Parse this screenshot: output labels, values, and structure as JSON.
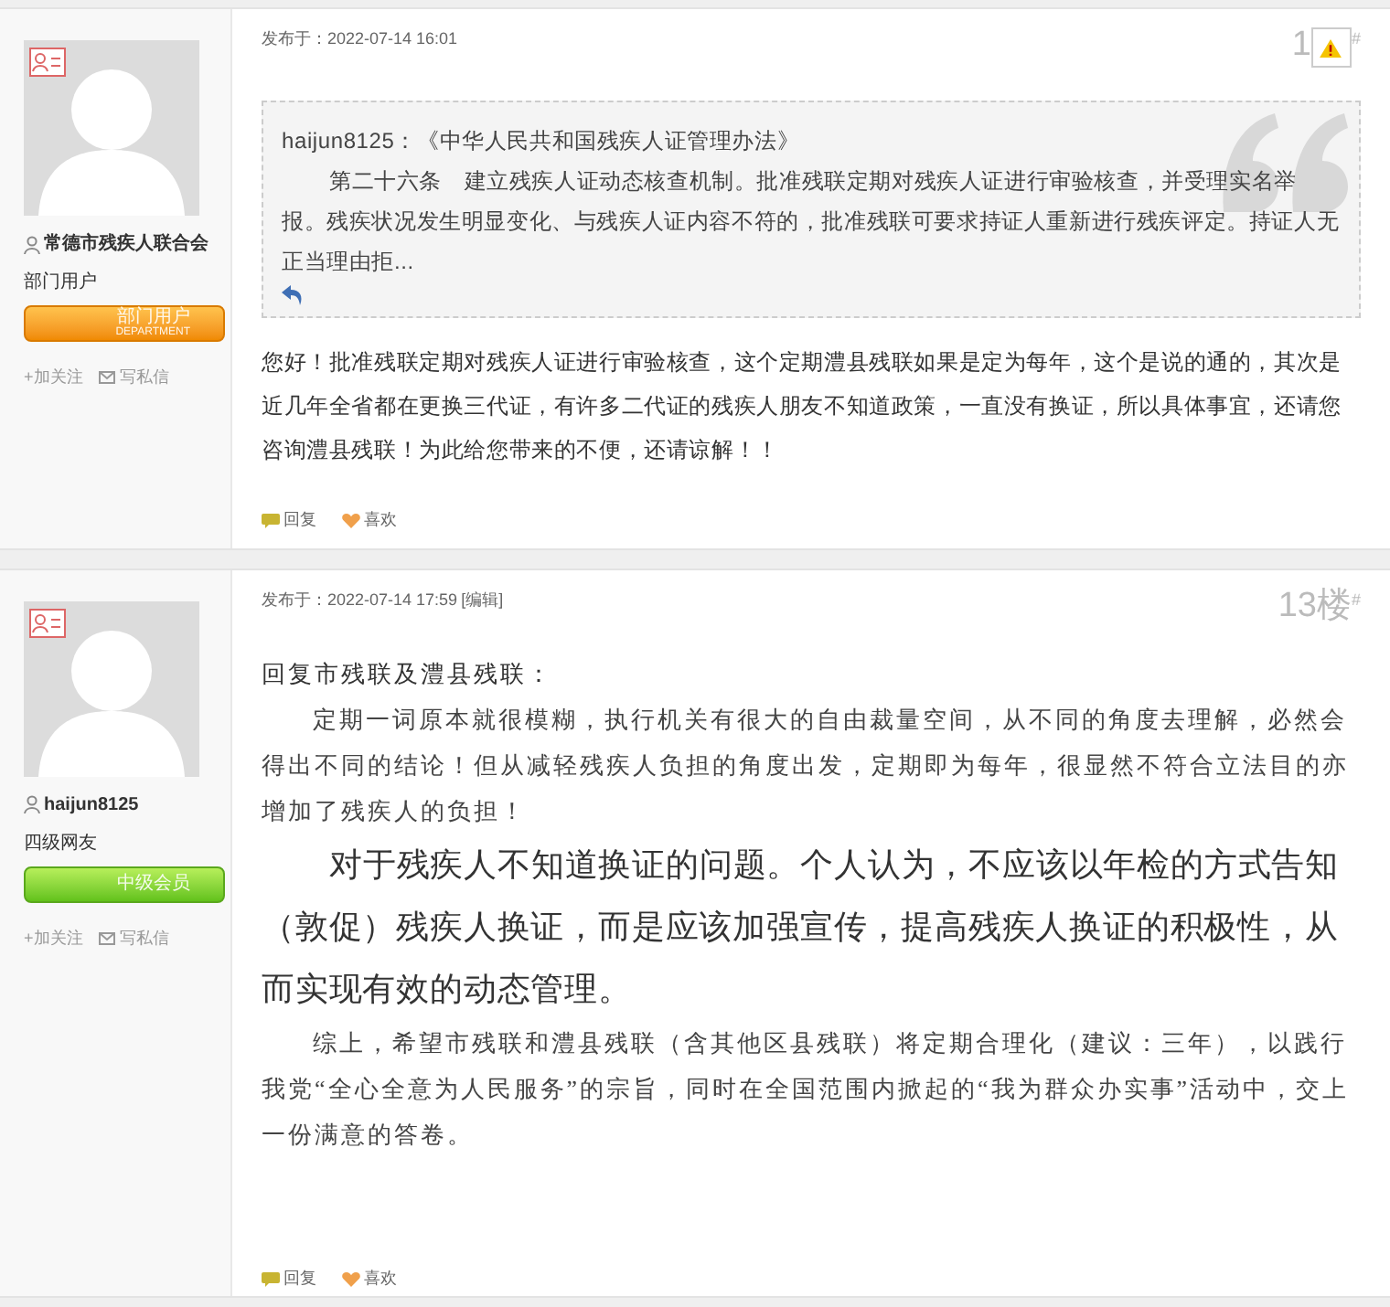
{
  "posts": [
    {
      "author": {
        "name": "常德市残疾人联合会",
        "rank": "部门用户",
        "badge": {
          "kind": "department",
          "text": "部门用户",
          "subtext": "DEPARTMENT"
        }
      },
      "follow": "+加关注",
      "message": "写私信",
      "posted": "发布于：2022-07-14 16:01",
      "floor": "1",
      "floor_mark": "#",
      "warning": true,
      "quote": {
        "lines": [
          "haijun8125：《中华人民共和国残疾人证管理办法》",
          "第二十六条　建立残疾人证动态核查机制。批准残联定期对残疾人证进行审验核查，并受理实名举报。残疾状况发生明显变化、与残疾人证内容不符的，批准残联可要求持证人重新进行残疾评定。持证人无正当理由拒..."
        ]
      },
      "paragraphs": [
        {
          "kind": "plain",
          "text": "您好！批准残联定期对残疾人证进行审验核查，这个定期澧县残联如果是定为每年，这个是说的通的，其次是近几年全省都在更换三代证，有许多二代证的残疾人朋友不知道政策，一直没有换证，所以具体事宜，还请您咨询澧县残联！为此给您带来的不便，还请谅解！！"
        }
      ],
      "actions": [
        "回复",
        "喜欢"
      ]
    },
    {
      "author": {
        "name": "haijun8125",
        "rank": "四级网友",
        "badge": {
          "kind": "member",
          "text": "中级会员"
        }
      },
      "follow": "+加关注",
      "message": "写私信",
      "posted": "发布于：2022-07-14 17:59",
      "edit": "[编辑]",
      "floor": "13楼",
      "floor_mark": "#",
      "warning": false,
      "paragraphs": [
        {
          "kind": "plain",
          "text": "回复市残联及澧县残联："
        },
        {
          "kind": "indent",
          "text": "定期一词原本就很模糊，执行机关有很大的自由裁量空间，从不同的角度去理解，必然会得出不同的结论！但从减轻残疾人负担的角度出发，定期即为每年，很显然不符合立法目的亦增加了残疾人的负担！"
        },
        {
          "kind": "large",
          "text": "对于残疾人不知道换证的问题。个人认为，不应该以年检的方式告知（敦促）残疾人换证，而是应该加强宣传，提高残疾人换证的积极性，从而实现有效的动态管理。"
        },
        {
          "kind": "indent",
          "text": "综上，希望市残联和澧县残联（含其他区县残联）将定期合理化（建议：三年），以践行我党“全心全意为人民服务”的宗旨，同时在全国范围内掀起的“我为群众办实事”活动中，交上一份满意的答卷。"
        }
      ],
      "actions": [
        "回复",
        "喜欢"
      ]
    }
  ]
}
